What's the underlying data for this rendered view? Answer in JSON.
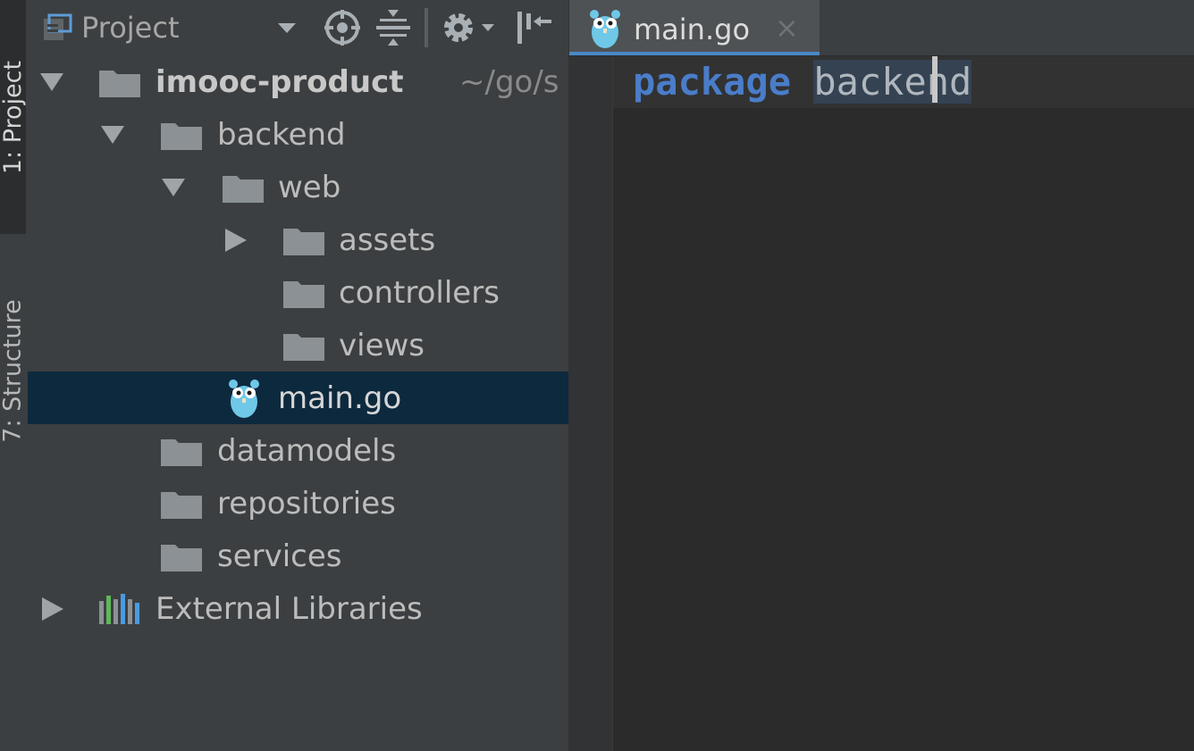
{
  "sidebar_tabs": {
    "project": "1: Project",
    "structure": "7: Structure"
  },
  "project_panel": {
    "title": "Project",
    "icons": [
      "dropdown-icon",
      "locate-icon",
      "collapse-icon",
      "gear-icon",
      "hide-icon"
    ],
    "tree": [
      {
        "label": "imooc-product",
        "suffix": "~/go/s",
        "expanded": true,
        "type": "folder"
      },
      {
        "label": "backend",
        "expanded": true,
        "type": "folder"
      },
      {
        "label": "web",
        "expanded": true,
        "type": "folder"
      },
      {
        "label": "assets",
        "expanded": false,
        "type": "folder"
      },
      {
        "label": "controllers",
        "type": "folder"
      },
      {
        "label": "views",
        "type": "folder"
      },
      {
        "label": "main.go",
        "type": "go-file",
        "selected": true
      },
      {
        "label": "datamodels",
        "type": "folder"
      },
      {
        "label": "repositories",
        "type": "folder"
      },
      {
        "label": "services",
        "type": "folder"
      },
      {
        "label": "External Libraries",
        "expanded": false,
        "type": "libraries"
      }
    ]
  },
  "editor": {
    "tab": {
      "label": "main.go",
      "close": "×"
    },
    "code": {
      "keyword": "package",
      "identifier": "backend"
    }
  },
  "colors": {
    "selection": "#0d293e",
    "keyword": "#4a7dc9",
    "tab_underline": "#4a88c7"
  }
}
